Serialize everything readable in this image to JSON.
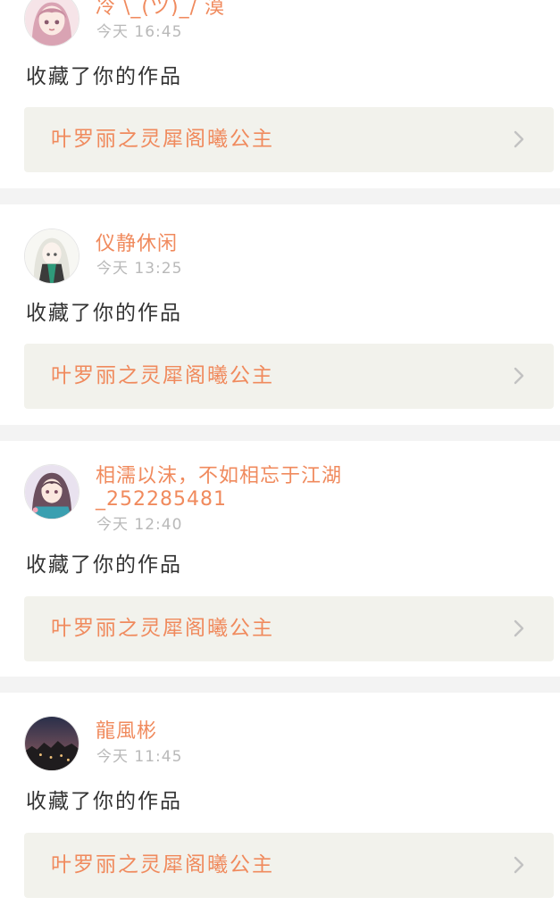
{
  "notifications": [
    {
      "username": "冷 \\_(ツ)_/ 漠",
      "time": "今天 16:45",
      "action": "收藏了你的作品",
      "work_title": "叶罗丽之灵犀阁曦公主",
      "avatar_icon": "pink-hair-girl-avatar"
    },
    {
      "username": "仪静休闲",
      "time": "今天 13:25",
      "action": "收藏了你的作品",
      "work_title": "叶罗丽之灵犀阁曦公主",
      "avatar_icon": "silver-hair-girl-avatar"
    },
    {
      "username": "相濡以沫，不如相忘于江湖_252285481",
      "time": "今天 12:40",
      "action": "收藏了你的作品",
      "work_title": "叶罗丽之灵犀阁曦公主",
      "avatar_icon": "anime-girl-avatar"
    },
    {
      "username": "龍風彬",
      "time": "今天 11:45",
      "action": "收藏了你的作品",
      "work_title": "叶罗丽之灵犀阁曦公主",
      "avatar_icon": "night-city-avatar"
    }
  ],
  "colors": {
    "accent": "#f08a5d",
    "action_text": "#333333",
    "time_text": "#b9b9b9",
    "work_box_bg": "#f2f2ec",
    "page_bg": "#f3f3f3",
    "card_bg": "#ffffff"
  }
}
